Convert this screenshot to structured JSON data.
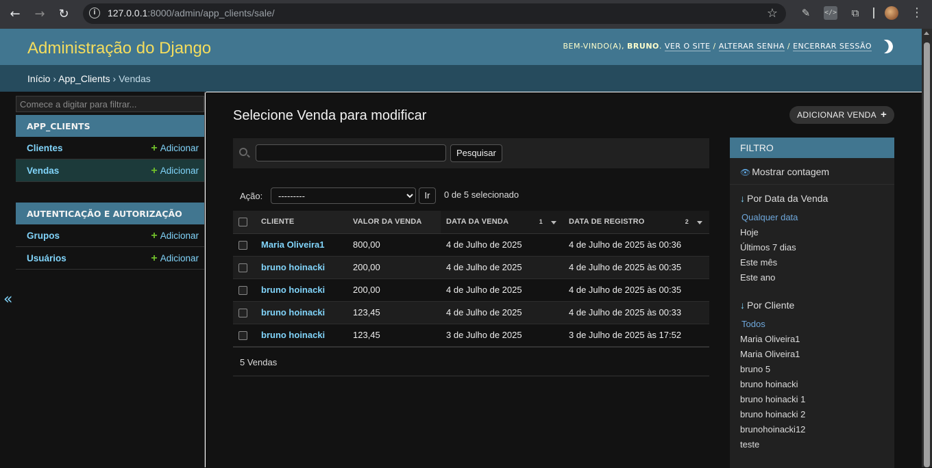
{
  "browser": {
    "url_host": "127.0.0.1",
    "url_rest": ":8000/admin/app_clients/sale/"
  },
  "header": {
    "brand": "Administração do Django",
    "welcome": "Bem-vindo(a),",
    "username": "bruno",
    "view_site": "Ver o site",
    "change_password": "Alterar senha",
    "logout": "Encerrar sessão"
  },
  "breadcrumbs": {
    "home": "Início",
    "app": "App_Clients",
    "current": "Vendas"
  },
  "sidebar": {
    "filter_placeholder": "Comece a digitar para filtrar...",
    "collapse": "«",
    "apps": [
      {
        "caption": "App_Clients",
        "models": [
          {
            "label": "Clientes",
            "add": "Adicionar"
          },
          {
            "label": "Vendas",
            "add": "Adicionar"
          }
        ]
      },
      {
        "caption": "Autenticação e Autorização",
        "models": [
          {
            "label": "Grupos",
            "add": "Adicionar"
          },
          {
            "label": "Usuários",
            "add": "Adicionar"
          }
        ]
      }
    ]
  },
  "main": {
    "title": "Selecione Venda para modificar",
    "add_button": "Adicionar Venda",
    "search_button": "Pesquisar",
    "action_label": "Ação:",
    "action_selected": "---------",
    "go_button": "Ir",
    "selection_counter": "0 de 5 selecionado",
    "columns": [
      "Cliente",
      "Valor da venda",
      "Data da venda",
      "Data de registro"
    ],
    "sort_priority": [
      "1",
      "2"
    ],
    "rows": [
      [
        "Maria Oliveira1",
        "800,00",
        "4 de Julho de 2025",
        "4 de Julho de 2025 às 00:36"
      ],
      [
        "bruno hoinacki",
        "200,00",
        "4 de Julho de 2025",
        "4 de Julho de 2025 às 00:35"
      ],
      [
        "bruno hoinacki",
        "200,00",
        "4 de Julho de 2025",
        "4 de Julho de 2025 às 00:35"
      ],
      [
        "bruno hoinacki",
        "123,45",
        "4 de Julho de 2025",
        "4 de Julho de 2025 às 00:33"
      ],
      [
        "bruno hoinacki",
        "123,45",
        "3 de Julho de 2025",
        "3 de Julho de 2025 às 17:52"
      ]
    ],
    "result_count": "5 Vendas"
  },
  "filter": {
    "caption": "Filtro",
    "show_count": "Mostrar contagem",
    "groups": [
      {
        "title": "Por Data da Venda",
        "options": [
          "Qualquer data",
          "Hoje",
          "Últimos 7 dias",
          "Este mês",
          "Este ano"
        ]
      },
      {
        "title": "Por Cliente",
        "options": [
          "Todos",
          "Maria Oliveira1",
          "Maria Oliveira1",
          "bruno 5",
          "bruno hoinacki",
          "bruno hoinacki 1",
          "bruno hoinacki 2",
          "brunohoinacki12",
          "teste"
        ]
      }
    ]
  },
  "colors": {
    "header_bg": "#417690",
    "breadcrumb_bg": "#264b5d",
    "brand": "#f5dd5d",
    "link": "#81d4fa",
    "add_plus": "#70bf2b"
  },
  "icons": [
    "back-arrow-icon",
    "forward-arrow-icon",
    "reload-icon",
    "site-info-icon",
    "star-icon",
    "eyedropper-icon",
    "devtools-icon",
    "extensions-icon",
    "avatar",
    "more-icon",
    "moon-icon",
    "search-icon",
    "eye-icon",
    "plus-icon"
  ]
}
